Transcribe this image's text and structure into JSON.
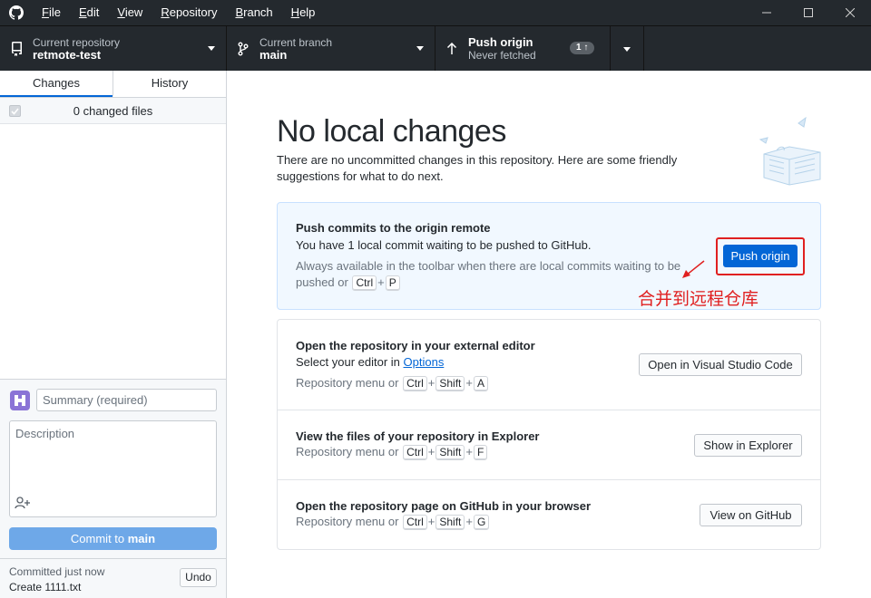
{
  "menu": [
    "File",
    "Edit",
    "View",
    "Repository",
    "Branch",
    "Help"
  ],
  "menu_underline": [
    "F",
    "E",
    "V",
    "R",
    "B",
    "H"
  ],
  "menu_rest": [
    "ile",
    "dit",
    "iew",
    "epository",
    "ranch",
    "elp"
  ],
  "toolbar": {
    "repo_sub": "Current repository",
    "repo_name": "retmote-test",
    "branch_sub": "Current branch",
    "branch_name": "main",
    "push_title": "Push origin",
    "push_sub": "Never fetched",
    "push_badge": "1 ↑"
  },
  "sidebar": {
    "tabs": [
      "Changes",
      "History"
    ],
    "changed_files": "0 changed files",
    "summary_placeholder": "Summary (required)",
    "description_placeholder": "Description",
    "commit_prefix": "Commit to ",
    "commit_branch": "main",
    "last_commit_when": "Committed just now",
    "last_commit_msg": "Create 1111.txt",
    "undo_label": "Undo"
  },
  "main": {
    "heading": "No local changes",
    "intro": "There are no uncommitted changes in this repository. Here are some friendly suggestions for what to do next.",
    "push_card": {
      "title": "Push commits to the origin remote",
      "desc": "You have 1 local commit waiting to be pushed to GitHub.",
      "meta": "Always available in the toolbar when there are local commits waiting to be pushed or",
      "keys": [
        "Ctrl",
        "P"
      ],
      "button": "Push origin",
      "annotation": "合并到远程仓库"
    },
    "editor_card": {
      "title": "Open the repository in your external editor",
      "desc": "Select your editor in ",
      "link": "Options",
      "meta": "Repository menu or",
      "keys": [
        "Ctrl",
        "Shift",
        "A"
      ],
      "button": "Open in Visual Studio Code"
    },
    "explorer_card": {
      "title": "View the files of your repository in Explorer",
      "meta": "Repository menu or",
      "keys": [
        "Ctrl",
        "Shift",
        "F"
      ],
      "button": "Show in Explorer"
    },
    "github_card": {
      "title": "Open the repository page on GitHub in your browser",
      "meta": "Repository menu or",
      "keys": [
        "Ctrl",
        "Shift",
        "G"
      ],
      "button": "View on GitHub"
    }
  },
  "colors": {
    "chrome": "#24292e",
    "accent": "#0366d6",
    "annotation": "#e02020"
  }
}
